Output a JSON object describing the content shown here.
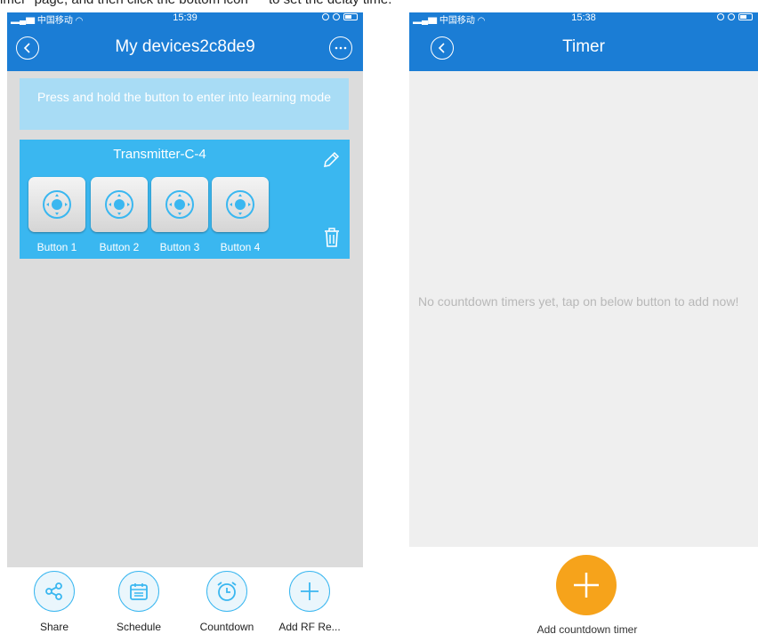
{
  "caption": "imer\" page, and then click the bottom icon \" \" to set the delay time.",
  "left": {
    "status": {
      "carrier": "中国移动",
      "time": "15:39"
    },
    "title": "My devices2c8de9",
    "hint": "Press and hold the button to enter into learning mode",
    "device": {
      "name": "Transmitter-C-4",
      "buttons": [
        "Button 1",
        "Button 2",
        "Button 3",
        "Button 4"
      ]
    },
    "tabs": [
      {
        "label": "Share",
        "icon": "share-icon"
      },
      {
        "label": "Schedule",
        "icon": "calendar-icon"
      },
      {
        "label": "Countdown",
        "icon": "alarm-clock-icon"
      },
      {
        "label": "Add RF Re...",
        "icon": "plus-icon"
      }
    ]
  },
  "right": {
    "status": {
      "carrier": "中国移动",
      "time": "15:38"
    },
    "title": "Timer",
    "empty_message": "No countdown timers yet, tap on below button to add now!",
    "add_label": "Add countdown timer"
  },
  "colors": {
    "nav_blue": "#1b7dd5",
    "card_blue": "#3ab7f0",
    "hint_blue": "#a8dcf5",
    "fab_orange": "#f6a31b",
    "content_gray": "#dcdcdc"
  }
}
